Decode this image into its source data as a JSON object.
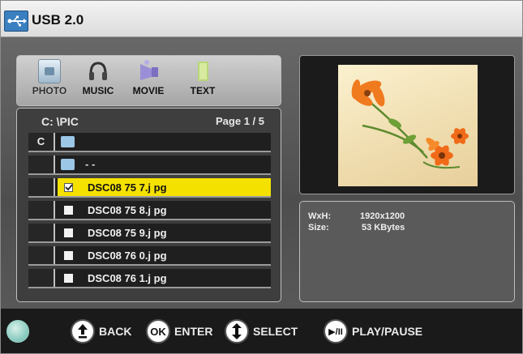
{
  "window": {
    "title": "USB 2.0"
  },
  "media_tabs": [
    {
      "label": "PHOTO",
      "icon": "photo-icon",
      "selected": true
    },
    {
      "label": "MUSIC",
      "icon": "headphones-icon",
      "selected": false
    },
    {
      "label": "MOVIE",
      "icon": "movie-icon",
      "selected": false
    },
    {
      "label": "TEXT",
      "icon": "text-document-icon",
      "selected": false
    }
  ],
  "browser": {
    "path": "C:   \\PIC",
    "page": "Page 1 / 5",
    "drive_letter": "C",
    "parent_label": "- -",
    "files": [
      {
        "name": "DSC08 75 7.j pg",
        "selected": true
      },
      {
        "name": "DSC08 75 8.j pg",
        "selected": false
      },
      {
        "name": "DSC08 75 9.j pg",
        "selected": false
      },
      {
        "name": "DSC08 76 0.j pg",
        "selected": false
      },
      {
        "name": "DSC08 76 1.j pg",
        "selected": false
      }
    ]
  },
  "info": {
    "wxh_label": "WxH:",
    "wxh_value": "1920x1200",
    "size_label": "Size:",
    "size_value": "53 KBytes"
  },
  "bottom": {
    "back_label": "BACK",
    "ok_symbol": "OK",
    "enter_label": "ENTER",
    "select_label": "SELECT",
    "playpause_symbol": "▶/II",
    "playpause_label": "PLAY/PAUSE"
  },
  "colors": {
    "highlight": "#f5e100",
    "background_dark": "#4e4e4e"
  }
}
